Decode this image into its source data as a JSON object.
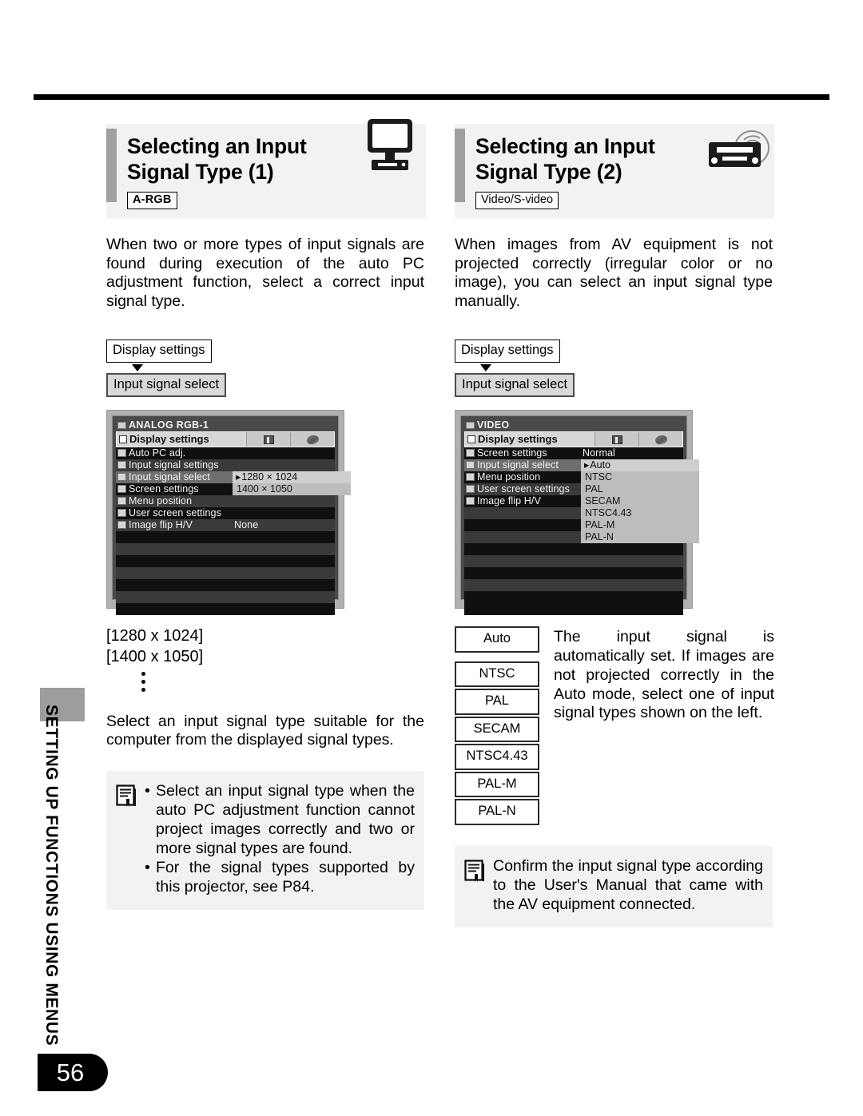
{
  "page": {
    "number": "56",
    "side_tab": "SETTING UP FUNCTIONS USING MENUS"
  },
  "left": {
    "title": "Selecting an Input Signal Type (1)",
    "tag": "A-RGB",
    "icon": "monitor-icon",
    "intro": "When two or more types of input signals are found during execution of the auto PC adjustment function, select a correct input signal type.",
    "breadcrumb": {
      "step1": "Display settings",
      "step2": "Input signal select"
    },
    "osd": {
      "source": "ANALOG RGB-1",
      "title": "Display settings",
      "rows": [
        {
          "label": "Auto PC adj.",
          "value": ""
        },
        {
          "label": "Input signal settings",
          "value": ""
        },
        {
          "label": "Input signal select",
          "value": ""
        },
        {
          "label": "Screen settings",
          "value": ""
        },
        {
          "label": "Menu position",
          "value": ""
        },
        {
          "label": "User screen settings",
          "value": ""
        },
        {
          "label": "Image flip H/V",
          "value": "None"
        }
      ],
      "submenu": [
        {
          "marker": "▸",
          "label": "1280 × 1024"
        },
        {
          "marker": "",
          "label": "1400 × 1050"
        }
      ]
    },
    "resolutions": [
      "[1280 x 1024]",
      "[1400 x 1050]"
    ],
    "after_text": "Select an input signal type suitable for the computer from the displayed signal types.",
    "note": {
      "icon": "note-icon",
      "bullets": [
        "Select an input signal type when the auto PC adjustment function cannot project images correctly and two or more signal types are found.",
        "For the signal types supported by this projector, see P84."
      ]
    }
  },
  "right": {
    "title": "Selecting an Input Signal Type (2)",
    "tag": "Video/S-video",
    "icon": "av-equipment-icon",
    "intro": "When images from AV equipment is not projected correctly (irregular color or no image), you can select an input signal type manually.",
    "breadcrumb": {
      "step1": "Display settings",
      "step2": "Input signal select"
    },
    "osd": {
      "source": "VIDEO",
      "title": "Display settings",
      "rows": [
        {
          "label": "Screen settings",
          "value": "Normal"
        },
        {
          "label": "Input signal select",
          "value": ""
        },
        {
          "label": "Menu position",
          "value": ""
        },
        {
          "label": "User screen settings",
          "value": ""
        },
        {
          "label": "Image flip H/V",
          "value": ""
        }
      ],
      "submenu": [
        {
          "marker": "▸",
          "label": "Auto"
        },
        {
          "marker": "",
          "label": "NTSC"
        },
        {
          "marker": "",
          "label": "PAL"
        },
        {
          "marker": "",
          "label": "SECAM"
        },
        {
          "marker": "",
          "label": "NTSC4.43"
        },
        {
          "marker": "",
          "label": "PAL-M"
        },
        {
          "marker": "",
          "label": "PAL-N"
        }
      ]
    },
    "options": [
      "Auto",
      "NTSC",
      "PAL",
      "SECAM",
      "NTSC4.43",
      "PAL-M",
      "PAL-N"
    ],
    "options_desc": "The input signal is automatically set. If images are not projected correctly in the Auto mode, select one of input signal types shown on the left.",
    "note": {
      "icon": "note-icon",
      "text": "Confirm the input signal type according to the User's Manual that came with the AV equipment connected."
    }
  }
}
